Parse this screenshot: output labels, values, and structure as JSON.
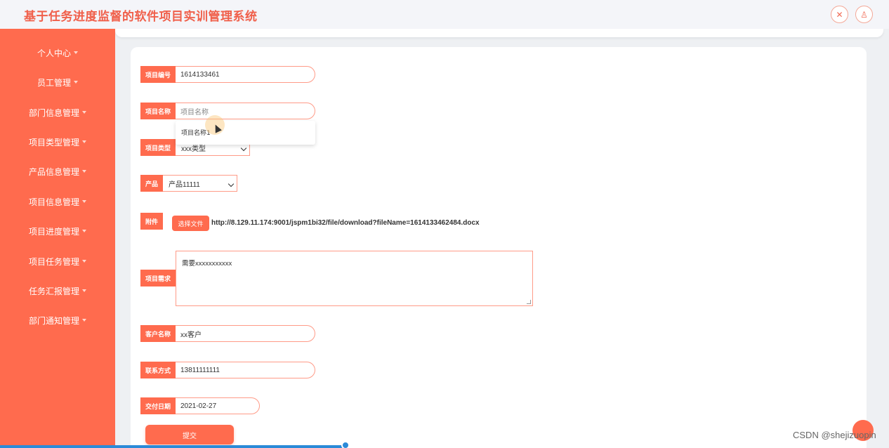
{
  "header": {
    "title": "基于任务进度监督的软件项目实训管理系统"
  },
  "sidebar": {
    "items": [
      {
        "label": "个人中心"
      },
      {
        "label": "员工管理"
      },
      {
        "label": "部门信息管理"
      },
      {
        "label": "项目类型管理"
      },
      {
        "label": "产品信息管理"
      },
      {
        "label": "项目信息管理"
      },
      {
        "label": "项目进度管理"
      },
      {
        "label": "项目任务管理"
      },
      {
        "label": "任务汇报管理"
      },
      {
        "label": "部门通知管理"
      }
    ]
  },
  "form": {
    "project_no": {
      "label": "项目编号",
      "value": "1614133461"
    },
    "project_name": {
      "label": "项目名称",
      "placeholder": "项目名称",
      "suggestion": "项目名称1"
    },
    "project_type": {
      "label": "项目类型",
      "selected": "xxx类型"
    },
    "product": {
      "label": "产品",
      "selected": "产品11111"
    },
    "attachment": {
      "label": "附件",
      "button": "选择文件",
      "url": "http://8.129.11.174:9001/jspm1bi32/file/download?fileName=1614133462484.docx"
    },
    "requirement": {
      "label": "项目需求",
      "value": "需要xxxxxxxxxxx"
    },
    "customer": {
      "label": "客户名称",
      "value": "xx客户"
    },
    "contact": {
      "label": "联系方式",
      "value": "13811111111"
    },
    "delivery_date": {
      "label": "交付日期",
      "value": "2021-02-27"
    },
    "submit": "提交"
  },
  "watermark": "CSDN @shejizuopin",
  "icons": {
    "fullscreen": "expand-icon",
    "user": "user-icon"
  }
}
